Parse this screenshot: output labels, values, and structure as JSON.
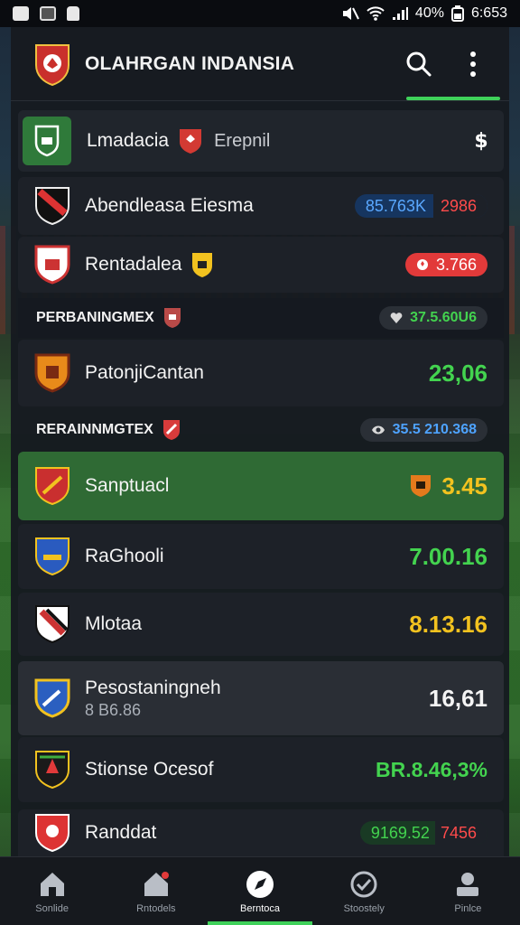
{
  "statusbar": {
    "battery_text": "40%",
    "time": "6:653"
  },
  "appbar": {
    "title": "OLAHRGAN INDANSIA"
  },
  "featured": {
    "name": "Lmadacia",
    "sub": "Erepnil"
  },
  "rows": [
    {
      "name": "Abendleasa Eiesma",
      "pill_left": "85.763K",
      "pill_right": "2986"
    },
    {
      "name": "Rentadalea",
      "pill": "3.766"
    },
    {
      "name": "PatonjiCantan",
      "value": "23,06"
    },
    {
      "name": "Sanptuacl",
      "value": "3.45"
    },
    {
      "name": "RaGhooli",
      "value": "7.00.16"
    },
    {
      "name": "Mlotaa",
      "value": "8.13.16"
    },
    {
      "name": "Pesostaningneh",
      "sub": "8 B6.86",
      "value": "16,61"
    },
    {
      "name": "Stionse Ocesof",
      "value": "BR.8.46,3%"
    },
    {
      "name": "Randdat",
      "pill_left": "9169.52",
      "pill_right": "7456"
    }
  ],
  "sections": [
    {
      "label": "PERBANINGMEX",
      "pill": "37.5.60U6"
    },
    {
      "label": "RERAINNMGTEX",
      "pill": "35.5 210.368"
    }
  ],
  "nav": [
    {
      "label": "Sonlide"
    },
    {
      "label": "Rntodels"
    },
    {
      "label": "Berntoca"
    },
    {
      "label": "Stoostely"
    },
    {
      "label": "Pinlce"
    }
  ],
  "colors": {
    "accent_green": "#3fd15a",
    "value_green": "#43d34f",
    "value_yellow": "#f2c21f",
    "pill_red": "#e23a3a",
    "pill_blue": "#1c4a8a",
    "highlight_row": "#2f6a34"
  }
}
